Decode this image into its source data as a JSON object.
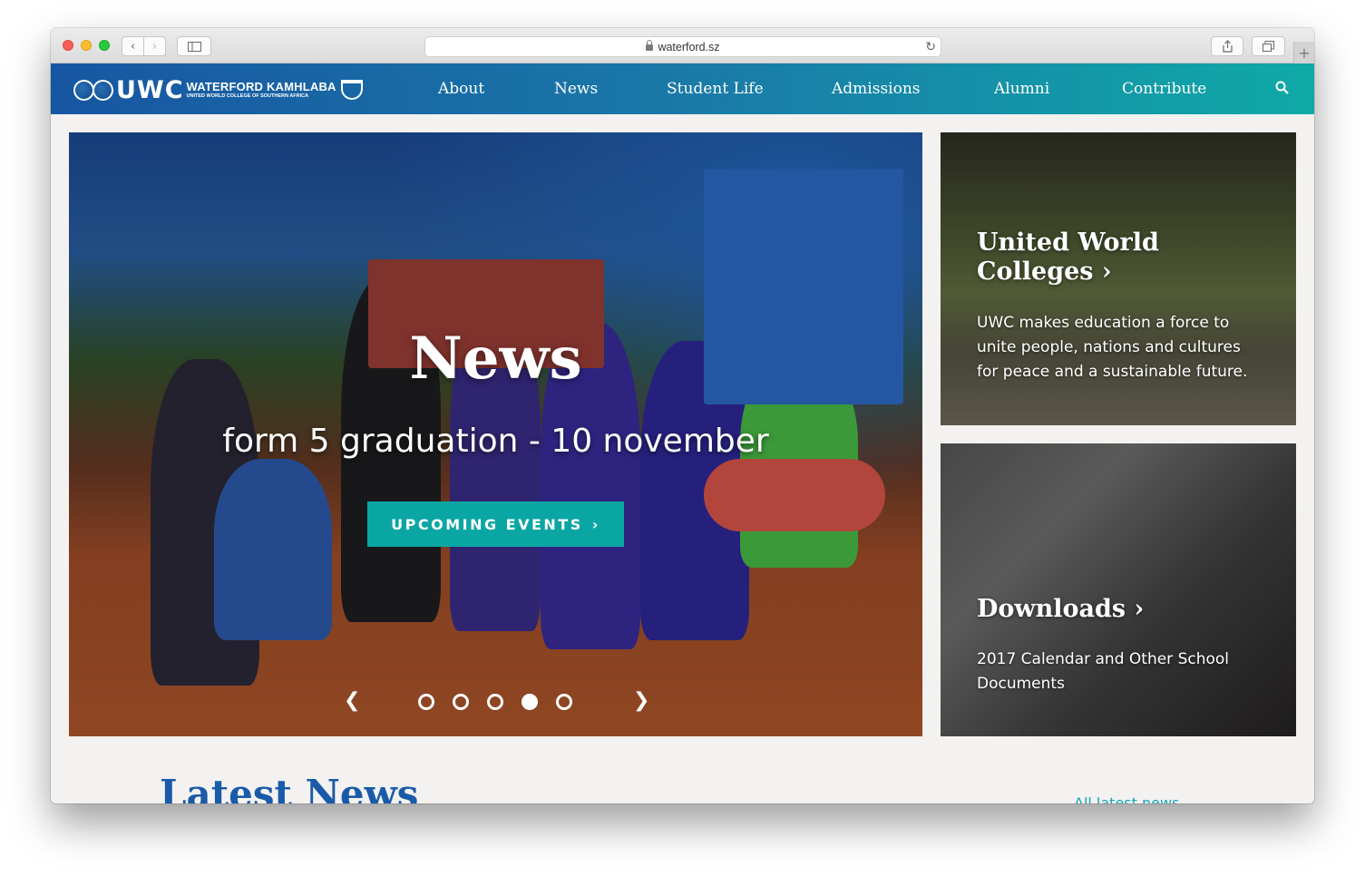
{
  "browser": {
    "url": "waterford.sz"
  },
  "site": {
    "logo": {
      "uwc": "UWC",
      "name": "WATERFORD KAMHLABA",
      "subtitle": "UNITED WORLD COLLEGE OF SOUTHERN AFRICA"
    },
    "nav": [
      {
        "label": "About"
      },
      {
        "label": "News"
      },
      {
        "label": "Student Life"
      },
      {
        "label": "Admissions"
      },
      {
        "label": "Alumni"
      },
      {
        "label": "Contribute"
      }
    ]
  },
  "hero": {
    "title": "News",
    "subtitle": "form 5 graduation - 10 november",
    "cta_label": "UPCOMING EVENTS",
    "cta_chevron": "›",
    "slide_count": 5,
    "active_slide": 4
  },
  "cards": [
    {
      "title": "United World Colleges ›",
      "text": "UWC makes education a force to unite people, nations and cultures for peace and a sustainable future."
    },
    {
      "title": "Downloads ›",
      "text": "2017 Calendar and Other School Documents"
    }
  ],
  "latest_news": {
    "heading": "Latest News",
    "all_link": "All latest news"
  },
  "colors": {
    "header_start": "#1756a2",
    "header_end": "#0fa9a7",
    "cta": "#0aa6a4",
    "heading": "#1a5aa9",
    "link": "#18a6b8"
  },
  "icons": {
    "search": "search-icon",
    "prev": "chevron-left-icon",
    "next": "chevron-right-icon"
  }
}
